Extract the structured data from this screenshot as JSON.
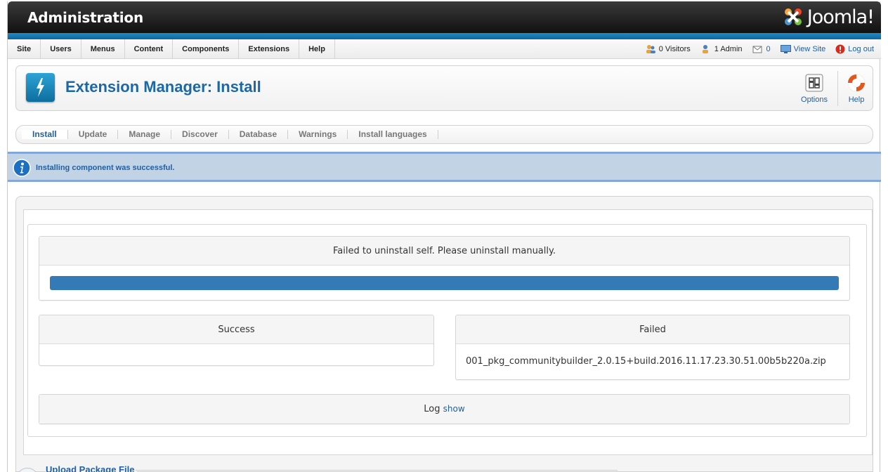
{
  "header": {
    "title": "Administration",
    "logo_text": "Joomla!"
  },
  "menu": {
    "items": [
      {
        "label": "Site"
      },
      {
        "label": "Users"
      },
      {
        "label": "Menus"
      },
      {
        "label": "Content"
      },
      {
        "label": "Components"
      },
      {
        "label": "Extensions"
      },
      {
        "label": "Help"
      }
    ]
  },
  "status": {
    "visitors": "0 Visitors",
    "admins": "1 Admin",
    "messages": "0",
    "view_site": "View Site",
    "logout": "Log out"
  },
  "toolbar": {
    "title": "Extension Manager: Install",
    "options_label": "Options",
    "help_label": "Help"
  },
  "submenu": {
    "items": [
      {
        "label": "Install",
        "active": true
      },
      {
        "label": "Update"
      },
      {
        "label": "Manage"
      },
      {
        "label": "Discover"
      },
      {
        "label": "Database"
      },
      {
        "label": "Warnings"
      },
      {
        "label": "Install languages"
      }
    ]
  },
  "message": {
    "text": "Installing component was successful."
  },
  "result": {
    "status_heading": "Failed to uninstall self. Please uninstall manually.",
    "progress": 1.0,
    "success_heading": "Success",
    "failed_heading": "Failed",
    "failed_items": [
      "001_pkg_communitybuilder_2.0.15+build.2016.11.17.23.30.51.00b5b220a.zip"
    ],
    "log_label": "Log",
    "log_link": "show"
  },
  "upload": {
    "legend": "Upload Package File"
  },
  "colors": {
    "accent": "#1f5fa5",
    "progress": "#337ab7",
    "message_bg": "#c3d3e6"
  }
}
